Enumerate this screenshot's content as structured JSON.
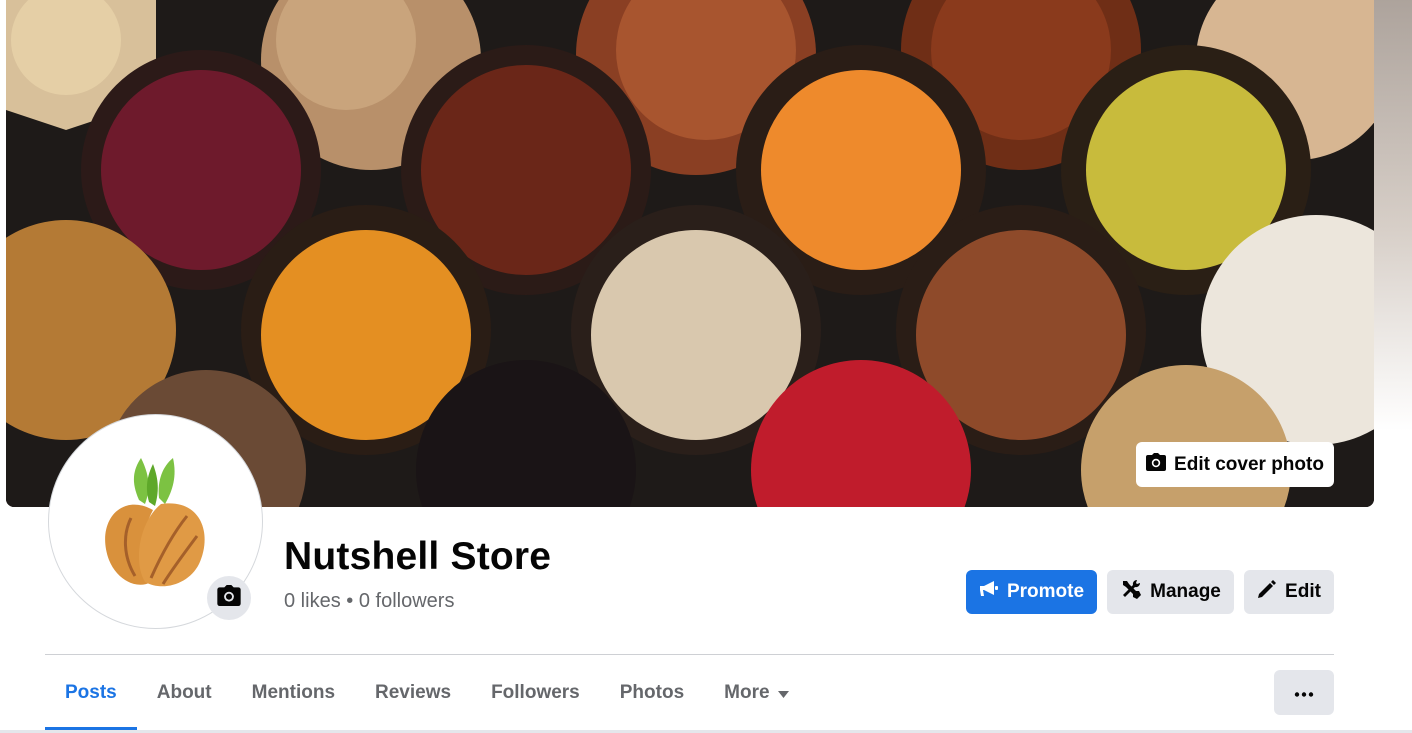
{
  "cover": {
    "edit_label": "Edit cover photo"
  },
  "page": {
    "name": "Nutshell Store",
    "likes": "0 likes",
    "separator": "•",
    "followers": "0 followers"
  },
  "actions": {
    "promote_label": "Promote",
    "manage_label": "Manage",
    "edit_label": "Edit"
  },
  "tabs": [
    {
      "label": "Posts",
      "active": true
    },
    {
      "label": "About",
      "active": false
    },
    {
      "label": "Mentions",
      "active": false
    },
    {
      "label": "Reviews",
      "active": false
    },
    {
      "label": "Followers",
      "active": false
    },
    {
      "label": "Photos",
      "active": false
    },
    {
      "label": "More",
      "active": false
    }
  ],
  "colors": {
    "accent": "#1b74e4",
    "secondary_button": "#e4e6eb",
    "muted_text": "#65676b"
  },
  "icons": {
    "cover_camera": "camera-icon",
    "avatar_camera": "camera-icon",
    "promote": "megaphone-icon",
    "manage": "tools-icon",
    "edit": "pencil-icon",
    "more_caret": "caret-down-icon",
    "overflow": "ellipsis-icon"
  }
}
